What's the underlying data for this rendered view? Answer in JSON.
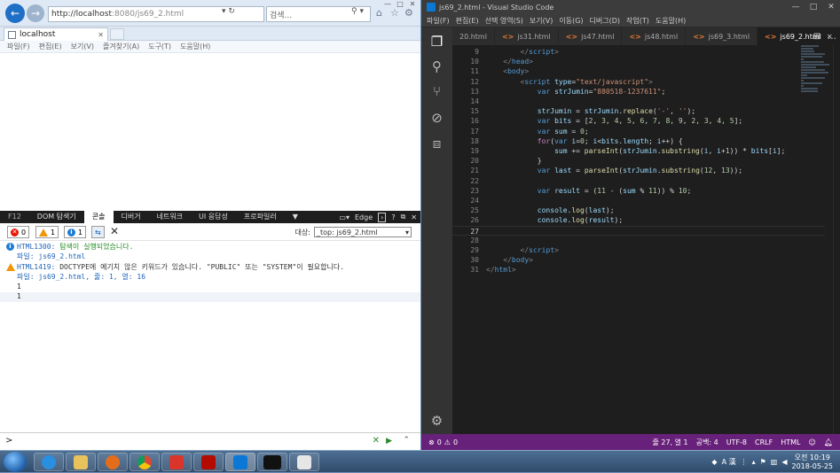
{
  "ie": {
    "url_host": "http://localhost",
    "url_rest": ":8080/js69_2.html",
    "url_tools": "▾ ↻",
    "search_placeholder": "검색...",
    "tab_title": "localhost",
    "menu": [
      "파일(F)",
      "편집(E)",
      "보기(V)",
      "즐겨찾기(A)",
      "도구(T)",
      "도움말(H)"
    ]
  },
  "f12": {
    "tabs": [
      "F12",
      "DOM 탐색기",
      "콘솔",
      "디버거",
      "네트워크",
      "UI 응답성",
      "프로파일러"
    ],
    "active_tab": "콘솔",
    "edge_label": "Edge",
    "filters": {
      "errors": "0",
      "warnings": "1",
      "info": "1"
    },
    "target_label": "대상:",
    "target_value": "_top: js69_2.html",
    "messages": {
      "m1_code": "HTML1300:",
      "m1_text": "탐색이 실행되었습니다.",
      "m1_file": "파일: js69_2.html",
      "m2_code": "HTML1419:",
      "m2_text": "DOCTYPE에 예기치 않은 키워드가 있습니다. \"PUBLIC\" 또는 \"SYSTEM\"이 필요합니다.",
      "m2_file": "파일: js69_2.html, 줄: 1, 열: 16",
      "log1": "1",
      "log2": "1"
    },
    "prompt": ">"
  },
  "vscode": {
    "title": "js69_2.html - Visual Studio Code",
    "menu": [
      "파일(F)",
      "편집(E)",
      "선택 영역(S)",
      "보기(V)",
      "이동(G)",
      "디버그(D)",
      "작업(T)",
      "도움말(H)"
    ],
    "tabs": [
      {
        "label": "20.html",
        "active": false
      },
      {
        "label": "js31.html",
        "active": false
      },
      {
        "label": "js47.html",
        "active": false
      },
      {
        "label": "js48.html",
        "active": false
      },
      {
        "label": "js69_3.html",
        "active": false
      },
      {
        "label": "js69_2.html",
        "active": true
      }
    ],
    "status": {
      "errors": "0",
      "warnings": "0",
      "position": "줄 27, 열 1",
      "spaces": "공백: 4",
      "encoding": "UTF-8",
      "eol": "CRLF",
      "language": "HTML"
    },
    "code": [
      {
        "n": "9",
        "html": "        <span class='c-punc'>&lt;/</span><span class='c-tag'>script</span><span class='c-punc'>&gt;</span>"
      },
      {
        "n": "10",
        "html": "    <span class='c-punc'>&lt;/</span><span class='c-tag'>head</span><span class='c-punc'>&gt;</span>"
      },
      {
        "n": "11",
        "html": "    <span class='c-punc'>&lt;</span><span class='c-tag'>body</span><span class='c-punc'>&gt;</span>"
      },
      {
        "n": "12",
        "html": "        <span class='c-punc'>&lt;</span><span class='c-tag'>script</span> <span class='c-attr'>type</span><span class='c-plain'>=</span><span class='c-str'>\"text/javascript\"</span><span class='c-punc'>&gt;</span>"
      },
      {
        "n": "13",
        "html": "            <span class='c-kw'>var</span> <span class='c-var'>strJumin</span><span class='c-plain'>=</span><span class='c-str'>\"880518-1237611\"</span><span class='c-plain'>;</span>"
      },
      {
        "n": "14",
        "html": ""
      },
      {
        "n": "15",
        "html": "            <span class='c-var'>strJumin</span> <span class='c-plain'>=</span> <span class='c-var'>strJumin</span><span class='c-plain'>.</span><span class='c-fn'>replace</span><span class='c-plain'>(</span><span class='c-str'>'-'</span><span class='c-plain'>, </span><span class='c-str'>''</span><span class='c-plain'>);</span>"
      },
      {
        "n": "16",
        "html": "            <span class='c-kw'>var</span> <span class='c-var'>bits</span> <span class='c-plain'>= [</span><span class='c-num'>2</span><span class='c-plain'>, </span><span class='c-num'>3</span><span class='c-plain'>, </span><span class='c-num'>4</span><span class='c-plain'>, </span><span class='c-num'>5</span><span class='c-plain'>, </span><span class='c-num'>6</span><span class='c-plain'>, </span><span class='c-num'>7</span><span class='c-plain'>, </span><span class='c-num'>8</span><span class='c-plain'>, </span><span class='c-num'>9</span><span class='c-plain'>, </span><span class='c-num'>2</span><span class='c-plain'>, </span><span class='c-num'>3</span><span class='c-plain'>, </span><span class='c-num'>4</span><span class='c-plain'>, </span><span class='c-num'>5</span><span class='c-plain'>];</span>"
      },
      {
        "n": "17",
        "html": "            <span class='c-kw'>var</span> <span class='c-var'>sum</span> <span class='c-plain'>= </span><span class='c-num'>0</span><span class='c-plain'>;</span>"
      },
      {
        "n": "18",
        "html": "            <span class='c-ctl'>for</span><span class='c-plain'>(</span><span class='c-kw'>var</span> <span class='c-var'>i</span><span class='c-plain'>=</span><span class='c-num'>0</span><span class='c-plain'>; </span><span class='c-var'>i</span><span class='c-plain'>&lt;</span><span class='c-var'>bits</span><span class='c-plain'>.</span><span class='c-var'>length</span><span class='c-plain'>; </span><span class='c-var'>i</span><span class='c-plain'>++) {</span>"
      },
      {
        "n": "19",
        "html": "                <span class='c-var'>sum</span> <span class='c-plain'>+= </span><span class='c-fn'>parseInt</span><span class='c-plain'>(</span><span class='c-var'>strJumin</span><span class='c-plain'>.</span><span class='c-fn'>substring</span><span class='c-plain'>(</span><span class='c-var'>i</span><span class='c-plain'>, </span><span class='c-var'>i</span><span class='c-plain'>+</span><span class='c-num'>1</span><span class='c-plain'>)) * </span><span class='c-var'>bits</span><span class='c-plain'>[</span><span class='c-var'>i</span><span class='c-plain'>];</span>"
      },
      {
        "n": "20",
        "html": "            <span class='c-plain'>}</span>"
      },
      {
        "n": "21",
        "html": "            <span class='c-kw'>var</span> <span class='c-var'>last</span> <span class='c-plain'>= </span><span class='c-fn'>parseInt</span><span class='c-plain'>(</span><span class='c-var'>strJumin</span><span class='c-plain'>.</span><span class='c-fn'>substring</span><span class='c-plain'>(</span><span class='c-num'>12</span><span class='c-plain'>, </span><span class='c-num'>13</span><span class='c-plain'>));</span>"
      },
      {
        "n": "22",
        "html": ""
      },
      {
        "n": "23",
        "html": "            <span class='c-kw'>var</span> <span class='c-var'>result</span> <span class='c-plain'>= (</span><span class='c-num'>11</span><span class='c-plain'> - (</span><span class='c-var'>sum</span><span class='c-plain'> % </span><span class='c-num'>11</span><span class='c-plain'>)) % </span><span class='c-num'>10</span><span class='c-plain'>;</span>"
      },
      {
        "n": "24",
        "html": ""
      },
      {
        "n": "25",
        "html": "            <span class='c-var'>console</span><span class='c-plain'>.</span><span class='c-fn'>log</span><span class='c-plain'>(</span><span class='c-var'>last</span><span class='c-plain'>);</span>"
      },
      {
        "n": "26",
        "html": "            <span class='c-var'>console</span><span class='c-plain'>.</span><span class='c-fn'>log</span><span class='c-plain'>(</span><span class='c-var'>result</span><span class='c-plain'>);</span>"
      },
      {
        "n": "27",
        "html": ""
      },
      {
        "n": "28",
        "html": ""
      },
      {
        "n": "29",
        "html": "        <span class='c-punc'>&lt;/</span><span class='c-tag'>script</span><span class='c-punc'>&gt;</span>"
      },
      {
        "n": "30",
        "html": "    <span class='c-punc'>&lt;/</span><span class='c-tag'>body</span><span class='c-punc'>&gt;</span>"
      },
      {
        "n": "31",
        "html": "<span class='c-punc'>&lt;/</span><span class='c-tag'>html</span><span class='c-punc'>&gt;</span>"
      }
    ],
    "current_line": "27"
  },
  "taskbar": {
    "ime": "A 漢",
    "time": "오전 10:19",
    "date": "2018-05-25",
    "apps": [
      "ie",
      "explorer",
      "media",
      "chrome",
      "app-red",
      "acrobat",
      "vscode",
      "terminal",
      "java"
    ]
  },
  "colors": {
    "vsc_status": "#68217a",
    "vsc_bg": "#1e1e1e",
    "ie_accent": "#1f6fc6"
  }
}
